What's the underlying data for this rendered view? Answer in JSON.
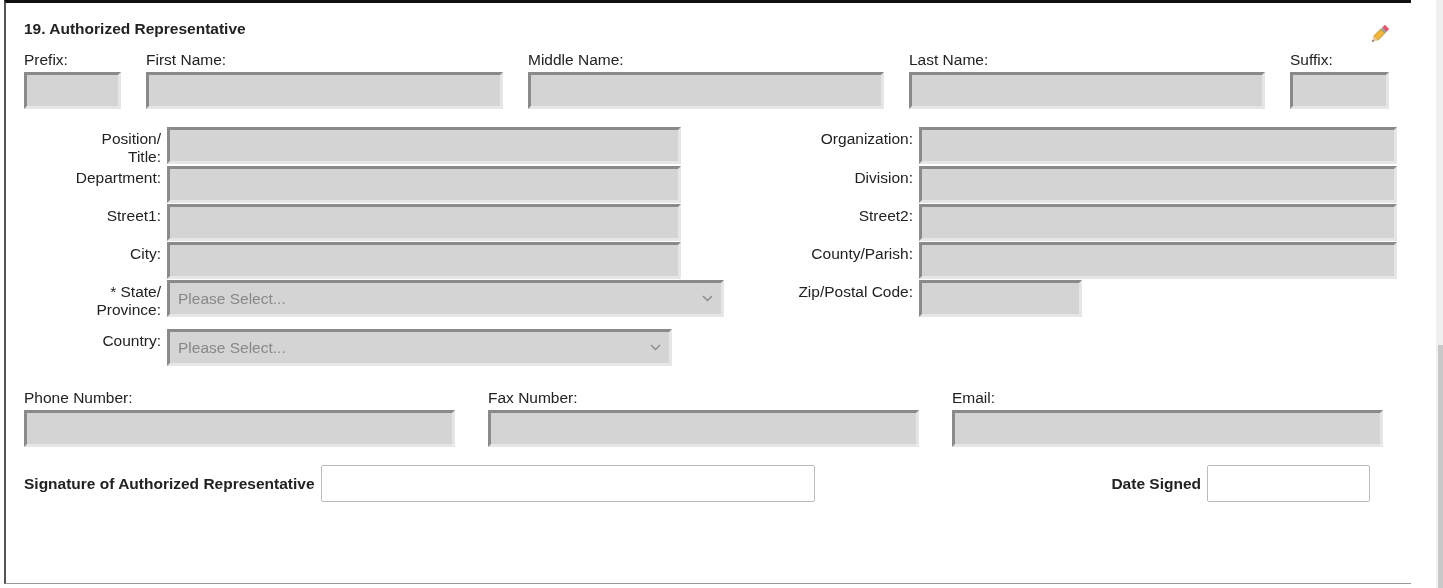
{
  "section": {
    "title": "19. Authorized Representative"
  },
  "name_fields": [
    {
      "label": "Prefix:",
      "disabled": true
    },
    {
      "label": "First Name:",
      "disabled": true
    },
    {
      "label": "Middle Name:",
      "disabled": true
    },
    {
      "label": "Last Name:",
      "disabled": true
    },
    {
      "label": "Suffix:",
      "disabled": true
    }
  ],
  "address_rows": [
    {
      "left": {
        "label": "Position/\nTitle:",
        "kind": "text",
        "disabled": true
      },
      "right": {
        "label": "Organization:",
        "kind": "text",
        "disabled": true
      }
    },
    {
      "left": {
        "label": "Department:",
        "kind": "text",
        "disabled": true
      },
      "right": {
        "label": "Division:",
        "kind": "text",
        "disabled": true
      }
    },
    {
      "left": {
        "label": "Street1:",
        "kind": "text",
        "disabled": true
      },
      "right": {
        "label": "Street2:",
        "kind": "text",
        "disabled": true
      }
    },
    {
      "left": {
        "label": "City:",
        "kind": "text",
        "disabled": true
      },
      "right": {
        "label": "County/Parish:",
        "kind": "text",
        "disabled": true
      }
    },
    {
      "left": {
        "label": "* State/\nProvince:",
        "kind": "select",
        "placeholder": "Please Select...",
        "disabled": true
      },
      "right": {
        "label": "Zip/Postal Code:",
        "kind": "short",
        "disabled": true
      }
    },
    {
      "left": {
        "label": "Country:",
        "kind": "select",
        "placeholder": "Please Select...",
        "disabled": true
      }
    }
  ],
  "contact_fields": [
    {
      "label": "Phone Number:",
      "disabled": true
    },
    {
      "label": "Fax Number:",
      "disabled": true
    },
    {
      "label": "Email:",
      "disabled": true
    }
  ],
  "signature": {
    "label": "Signature of Authorized Representative",
    "disabled": false
  },
  "date_signed": {
    "label": "Date Signed",
    "disabled": false
  }
}
